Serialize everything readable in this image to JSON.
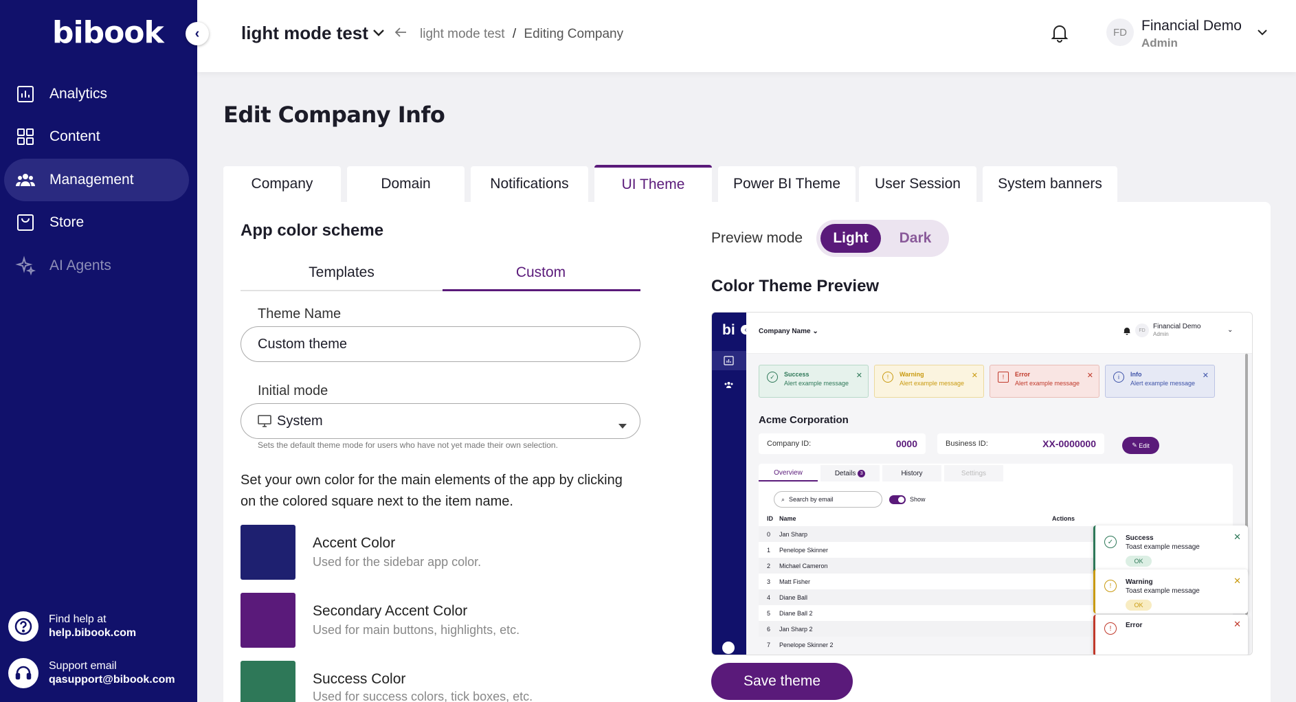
{
  "sidebar": {
    "logo": "bibook",
    "collapse_icon": "‹",
    "items": [
      {
        "label": "Analytics",
        "icon": "analytics-icon"
      },
      {
        "label": "Content",
        "icon": "content-icon"
      },
      {
        "label": "Management",
        "icon": "management-icon",
        "active": true
      },
      {
        "label": "Store",
        "icon": "store-icon"
      },
      {
        "label": "AI Agents",
        "icon": "ai-agents-icon",
        "disabled": true
      }
    ],
    "help": {
      "line1": "Find help at",
      "line2": "help.bibook.com"
    },
    "support": {
      "line1": "Support email",
      "line2": "qasupport@bibook.com"
    }
  },
  "header": {
    "title": "light mode test",
    "breadcrumb_root": "light mode test",
    "breadcrumb_sep": "/",
    "breadcrumb_current": "Editing Company",
    "user_initials": "FD",
    "user_name": "Financial Demo",
    "user_role": "Admin"
  },
  "page": {
    "title": "Edit Company Info",
    "tabs": [
      "Company",
      "Domain",
      "Notifications",
      "UI Theme",
      "Power BI Theme",
      "User Session",
      "System banners"
    ],
    "active_tab": "UI Theme"
  },
  "scheme": {
    "heading": "App color scheme",
    "subtabs": [
      "Templates",
      "Custom"
    ],
    "theme_name_label": "Theme Name",
    "theme_name_value": "Custom theme",
    "initial_mode_label": "Initial mode",
    "initial_mode_value": "System",
    "initial_mode_hint": "Sets the default theme mode for users who have not yet made their own selection.",
    "description": "Set your own color for the main elements of the app by clicking on the colored square next to the item name.",
    "colors": [
      {
        "name": "Accent Color",
        "desc": "Used for the sidebar app color.",
        "hex": "#1e2070"
      },
      {
        "name": "Secondary Accent Color",
        "desc": "Used for main buttons, highlights, etc.",
        "hex": "#5a1a7a"
      },
      {
        "name": "Success Color",
        "desc": "Used for success colors, tick boxes, etc.",
        "hex": "#2e7858"
      }
    ]
  },
  "preview_mode": {
    "label": "Preview mode",
    "light": "Light",
    "dark": "Dark"
  },
  "preview": {
    "heading": "Color Theme Preview",
    "logo": "bi",
    "company_name": "Company Name",
    "user_initials": "FD",
    "user_name": "Financial Demo",
    "user_role": "Admin",
    "alerts": [
      {
        "title": "Success",
        "msg": "Alert example message",
        "color": "#2e7858",
        "bg": "#e6f2ec"
      },
      {
        "title": "Warning",
        "msg": "Alert example message",
        "color": "#c99a10",
        "bg": "#fbf4df"
      },
      {
        "title": "Error",
        "msg": "Alert example message",
        "color": "#c0392b",
        "bg": "#f9e5e3"
      },
      {
        "title": "Info",
        "msg": "Alert example message",
        "color": "#3d52a8",
        "bg": "#e6e9f5"
      }
    ],
    "corp": "Acme Corporation",
    "company_id_label": "Company ID:",
    "company_id": "0000",
    "business_id_label": "Business ID:",
    "business_id": "XX-0000000",
    "edit": "Edit",
    "tabs": [
      "Overview",
      "Details",
      "History",
      "Settings"
    ],
    "details_badge": "3",
    "search_placeholder": "Search by email",
    "show_label": "Show",
    "col_id": "ID",
    "col_name": "Name",
    "col_actions": "Actions",
    "rows": [
      {
        "id": "0",
        "name": "Jan Sharp"
      },
      {
        "id": "1",
        "name": "Penelope Skinner"
      },
      {
        "id": "2",
        "name": "Michael Cameron"
      },
      {
        "id": "3",
        "name": "Matt Fisher"
      },
      {
        "id": "4",
        "name": "Diane Ball"
      },
      {
        "id": "5",
        "name": "Diane Ball 2"
      },
      {
        "id": "6",
        "name": "Jan Sharp 2"
      },
      {
        "id": "7",
        "name": "Penelope Skinner 2"
      }
    ],
    "toasts": [
      {
        "title": "Success",
        "msg": "Toast example message",
        "ok": "OK",
        "color": "#2e7858"
      },
      {
        "title": "Warning",
        "msg": "Toast example message",
        "ok": "OK",
        "color": "#c99a10"
      },
      {
        "title": "Error",
        "msg": "",
        "ok": "",
        "color": "#c0392b"
      }
    ]
  },
  "save_label": "Save theme"
}
